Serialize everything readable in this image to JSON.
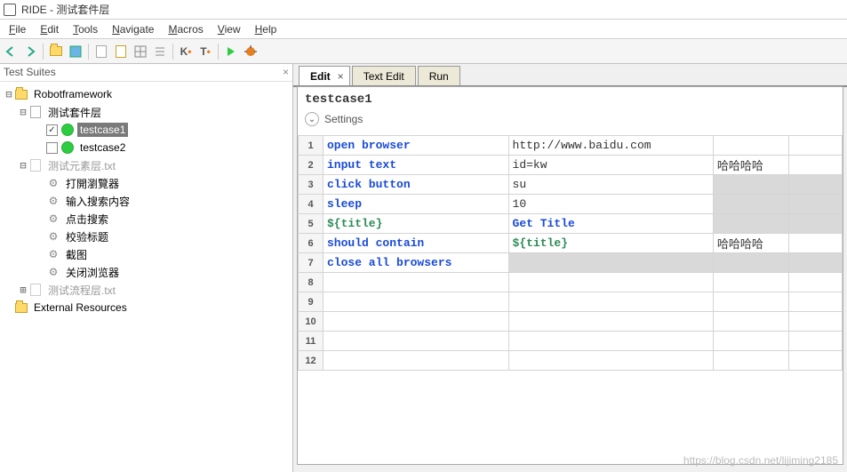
{
  "window_title": "RIDE - 测试套件层",
  "menu": [
    "File",
    "Edit",
    "Tools",
    "Navigate",
    "Macros",
    "View",
    "Help"
  ],
  "left_pane_title": "Test Suites",
  "tree": {
    "root": "Robotframework",
    "suite": "测试套件层",
    "tc1": "testcase1",
    "tc2": "testcase2",
    "resource1": "测试元素层.txt",
    "kw1": "打開瀏覽器",
    "kw2": "输入搜索内容",
    "kw3": "点击搜索",
    "kw4": "校验标题",
    "kw5": "截图",
    "kw6": "关闭浏览器",
    "resource2": "测试流程层.txt",
    "external": "External Resources"
  },
  "tabs": {
    "t1": "Edit",
    "t2": "Text Edit",
    "t3": "Run"
  },
  "tc_title": "testcase1",
  "settings_label": "Settings",
  "rows": [
    {
      "n": "1",
      "c1": "open browser",
      "c2": "http://www.baidu.com",
      "c3": "",
      "c1cls": "kw-blue",
      "c2cls": "plain",
      "c3cls": "",
      "s3": false
    },
    {
      "n": "2",
      "c1": "input text",
      "c2": "id=kw",
      "c3": "哈哈哈哈",
      "c1cls": "kw-blue",
      "c2cls": "plain",
      "c3cls": "plain",
      "s3": false
    },
    {
      "n": "3",
      "c1": "click button",
      "c2": "su",
      "c3": "",
      "c1cls": "kw-blue",
      "c2cls": "plain",
      "c3cls": "",
      "s3": true
    },
    {
      "n": "4",
      "c1": "sleep",
      "c2": "10",
      "c3": "",
      "c1cls": "kw-blue",
      "c2cls": "plain",
      "c3cls": "",
      "s3": true
    },
    {
      "n": "5",
      "c1": "${title}",
      "c2": "Get Title",
      "c3": "",
      "c1cls": "var-green",
      "c2cls": "kw-blue",
      "c3cls": "",
      "s3": true
    },
    {
      "n": "6",
      "c1": "should contain",
      "c2": "${title}",
      "c3": "哈哈哈哈",
      "c1cls": "kw-blue",
      "c2cls": "var-green",
      "c3cls": "plain",
      "s3": false
    },
    {
      "n": "7",
      "c1": "close all browsers",
      "c2": "",
      "c3": "",
      "c1cls": "kw-blue",
      "c2cls": "",
      "c3cls": "",
      "s2": true,
      "s3": true
    },
    {
      "n": "8",
      "c1": "",
      "c2": "",
      "c3": ""
    },
    {
      "n": "9",
      "c1": "",
      "c2": "",
      "c3": ""
    },
    {
      "n": "10",
      "c1": "",
      "c2": "",
      "c3": ""
    },
    {
      "n": "11",
      "c1": "",
      "c2": "",
      "c3": ""
    },
    {
      "n": "12",
      "c1": "",
      "c2": "",
      "c3": ""
    }
  ],
  "watermark": "https://blog.csdn.net/lijiming2185"
}
